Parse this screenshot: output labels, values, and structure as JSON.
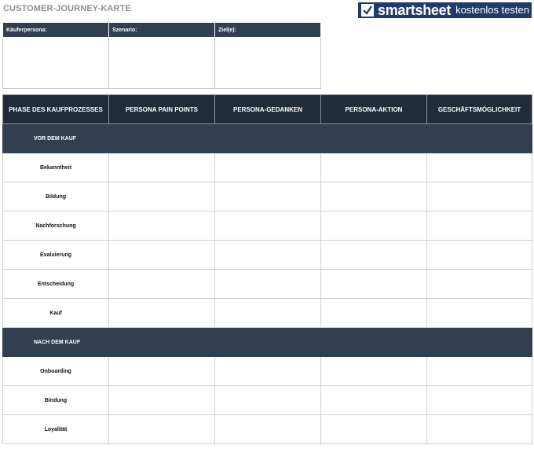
{
  "page": {
    "title": "CUSTOMER-JOURNEY-KARTE"
  },
  "banner": {
    "brand": "smartsheet",
    "cta": "kostenlos testen",
    "icon": "check-icon",
    "color": "#1f3a6b"
  },
  "info": {
    "headers": [
      "Käuferpersona:",
      "Szenario:",
      "Ziel(e):"
    ]
  },
  "journey": {
    "headers": [
      "PHASE DES KAUFPROZESSES",
      "PERSONA PAIN POINTS",
      "PERSONA-GEDANKEN",
      "PERSONA-AKTION",
      "GESCHÄFTSMÖGLICHKEIT"
    ],
    "sections": [
      {
        "label": "VOR DEM KAUF",
        "rows": [
          "Bekanntheit",
          "Bildung",
          "Nachforschung",
          "Evaluierung",
          "Entscheidung",
          "Kauf"
        ]
      },
      {
        "label": "NACH DEM KAUF",
        "rows": [
          "Onboarding",
          "Bindung",
          "Loyalität"
        ]
      }
    ]
  },
  "colors": {
    "header_dark": "#222b38",
    "section_bg": "#323f50",
    "title_gray": "#8a8f96"
  }
}
